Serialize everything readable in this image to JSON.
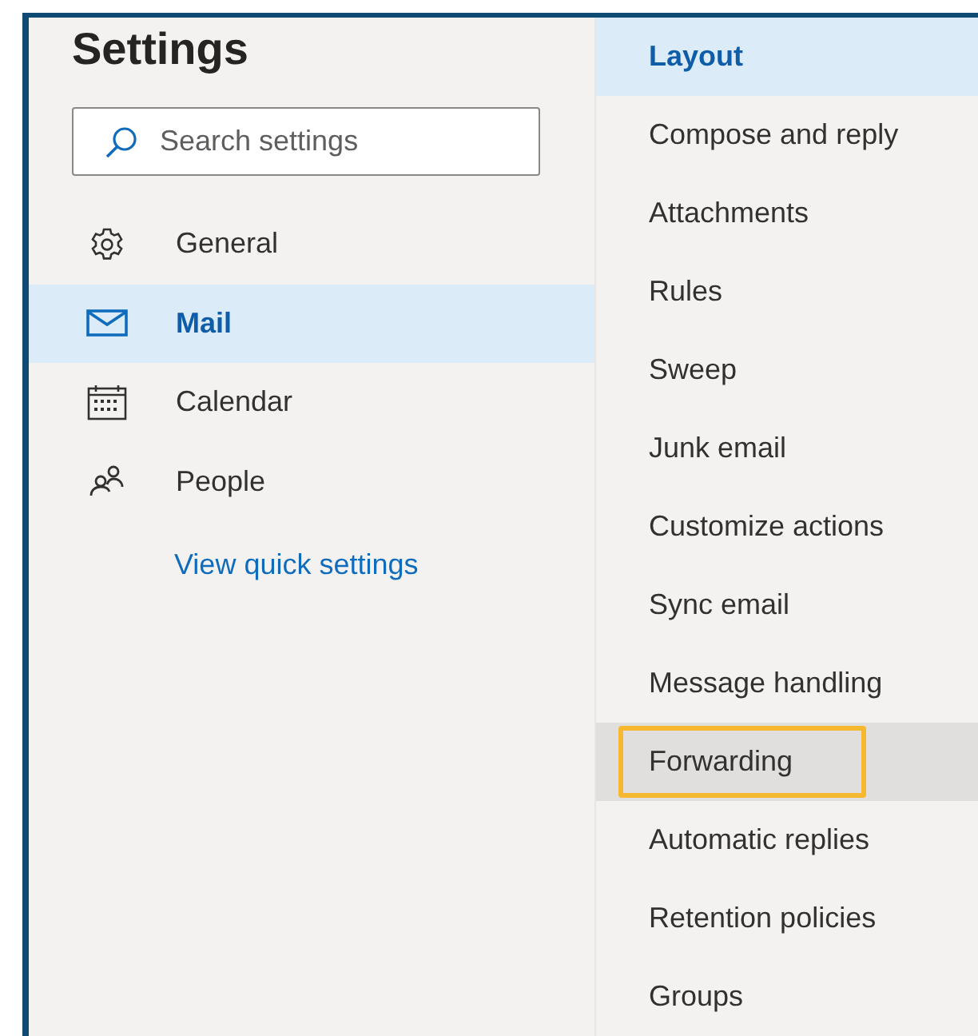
{
  "title": "Settings",
  "search": {
    "placeholder": "Search settings"
  },
  "nav": [
    {
      "label": "General",
      "selected": false
    },
    {
      "label": "Mail",
      "selected": true
    },
    {
      "label": "Calendar",
      "selected": false
    },
    {
      "label": "People",
      "selected": false
    }
  ],
  "link": "View quick settings",
  "submenu": [
    {
      "label": "Layout",
      "selected": true,
      "hovered": false,
      "highlighted": false
    },
    {
      "label": "Compose and reply",
      "selected": false,
      "hovered": false,
      "highlighted": false
    },
    {
      "label": "Attachments",
      "selected": false,
      "hovered": false,
      "highlighted": false
    },
    {
      "label": "Rules",
      "selected": false,
      "hovered": false,
      "highlighted": false
    },
    {
      "label": "Sweep",
      "selected": false,
      "hovered": false,
      "highlighted": false
    },
    {
      "label": "Junk email",
      "selected": false,
      "hovered": false,
      "highlighted": false
    },
    {
      "label": "Customize actions",
      "selected": false,
      "hovered": false,
      "highlighted": false
    },
    {
      "label": "Sync email",
      "selected": false,
      "hovered": false,
      "highlighted": false
    },
    {
      "label": "Message handling",
      "selected": false,
      "hovered": false,
      "highlighted": false
    },
    {
      "label": "Forwarding",
      "selected": false,
      "hovered": true,
      "highlighted": true
    },
    {
      "label": "Automatic replies",
      "selected": false,
      "hovered": false,
      "highlighted": false
    },
    {
      "label": "Retention policies",
      "selected": false,
      "hovered": false,
      "highlighted": false
    },
    {
      "label": "Groups",
      "selected": false,
      "hovered": false,
      "highlighted": false
    }
  ]
}
